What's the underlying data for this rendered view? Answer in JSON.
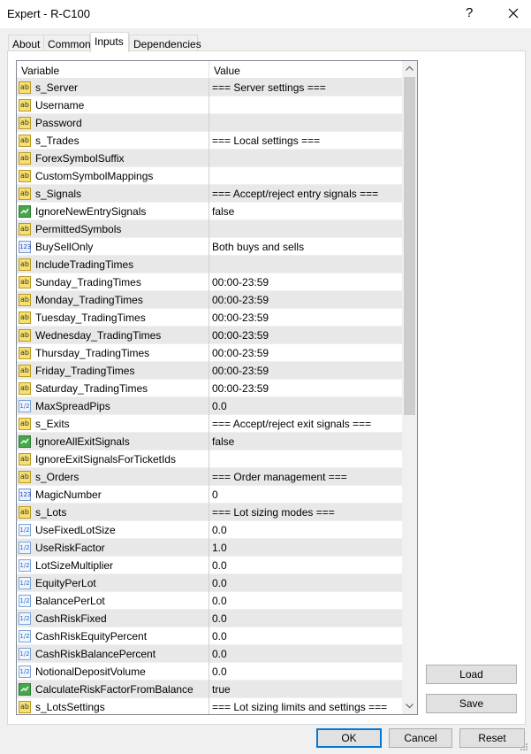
{
  "window": {
    "title": "Expert - R-C100",
    "help": "?"
  },
  "tabs": [
    {
      "label": "About"
    },
    {
      "label": "Common"
    },
    {
      "label": "Inputs"
    },
    {
      "label": "Dependencies"
    }
  ],
  "grid": {
    "columns": {
      "variable": "Variable",
      "value": "Value"
    },
    "rows": [
      {
        "type": "ab",
        "name": "s_Server",
        "value": "=== Server settings ==="
      },
      {
        "type": "ab",
        "name": "Username",
        "value": ""
      },
      {
        "type": "ab",
        "name": "Password",
        "value": ""
      },
      {
        "type": "ab",
        "name": "s_Trades",
        "value": "=== Local settings ==="
      },
      {
        "type": "ab",
        "name": "ForexSymbolSuffix",
        "value": ""
      },
      {
        "type": "ab",
        "name": "CustomSymbolMappings",
        "value": ""
      },
      {
        "type": "ab",
        "name": "s_Signals",
        "value": "=== Accept/reject entry signals ==="
      },
      {
        "type": "bool",
        "name": "IgnoreNewEntrySignals",
        "value": "false"
      },
      {
        "type": "ab",
        "name": "PermittedSymbols",
        "value": ""
      },
      {
        "type": "num",
        "name": "BuySellOnly",
        "value": "Both buys and sells"
      },
      {
        "type": "ab",
        "name": "IncludeTradingTimes",
        "value": ""
      },
      {
        "type": "ab",
        "name": "Sunday_TradingTimes",
        "value": "00:00-23:59"
      },
      {
        "type": "ab",
        "name": "Monday_TradingTimes",
        "value": "00:00-23:59"
      },
      {
        "type": "ab",
        "name": "Tuesday_TradingTimes",
        "value": "00:00-23:59"
      },
      {
        "type": "ab",
        "name": "Wednesday_TradingTimes",
        "value": "00:00-23:59"
      },
      {
        "type": "ab",
        "name": "Thursday_TradingTimes",
        "value": "00:00-23:59"
      },
      {
        "type": "ab",
        "name": "Friday_TradingTimes",
        "value": "00:00-23:59"
      },
      {
        "type": "ab",
        "name": "Saturday_TradingTimes",
        "value": "00:00-23:59"
      },
      {
        "type": "dbl",
        "name": "MaxSpreadPips",
        "value": "0.0"
      },
      {
        "type": "ab",
        "name": "s_Exits",
        "value": "=== Accept/reject exit signals ==="
      },
      {
        "type": "bool",
        "name": "IgnoreAllExitSignals",
        "value": "false"
      },
      {
        "type": "ab",
        "name": "IgnoreExitSignalsForTicketIds",
        "value": ""
      },
      {
        "type": "ab",
        "name": "s_Orders",
        "value": "=== Order management ==="
      },
      {
        "type": "num",
        "name": "MagicNumber",
        "value": "0"
      },
      {
        "type": "ab",
        "name": "s_Lots",
        "value": "=== Lot sizing modes ==="
      },
      {
        "type": "dbl",
        "name": "UseFixedLotSize",
        "value": "0.0"
      },
      {
        "type": "dbl",
        "name": "UseRiskFactor",
        "value": "1.0"
      },
      {
        "type": "dbl",
        "name": "LotSizeMultiplier",
        "value": "0.0"
      },
      {
        "type": "dbl",
        "name": "EquityPerLot",
        "value": "0.0"
      },
      {
        "type": "dbl",
        "name": "BalancePerLot",
        "value": "0.0"
      },
      {
        "type": "dbl",
        "name": "CashRiskFixed",
        "value": "0.0"
      },
      {
        "type": "dbl",
        "name": "CashRiskEquityPercent",
        "value": "0.0"
      },
      {
        "type": "dbl",
        "name": "CashRiskBalancePercent",
        "value": "0.0"
      },
      {
        "type": "dbl",
        "name": "NotionalDepositVolume",
        "value": "0.0"
      },
      {
        "type": "bool",
        "name": "CalculateRiskFactorFromBalance",
        "value": "true"
      },
      {
        "type": "ab",
        "name": "s_LotsSettings",
        "value": "=== Lot sizing limits and settings ==="
      }
    ]
  },
  "icon_glyphs": {
    "ab": "ab",
    "num": "123",
    "dbl": "1/2"
  },
  "buttons": {
    "load": "Load",
    "save": "Save",
    "ok": "OK",
    "cancel": "Cancel",
    "reset": "Reset"
  },
  "colors": {
    "accent": "#0078d7",
    "string_icon": "#f7e070",
    "bool_icon": "#46a84a"
  }
}
